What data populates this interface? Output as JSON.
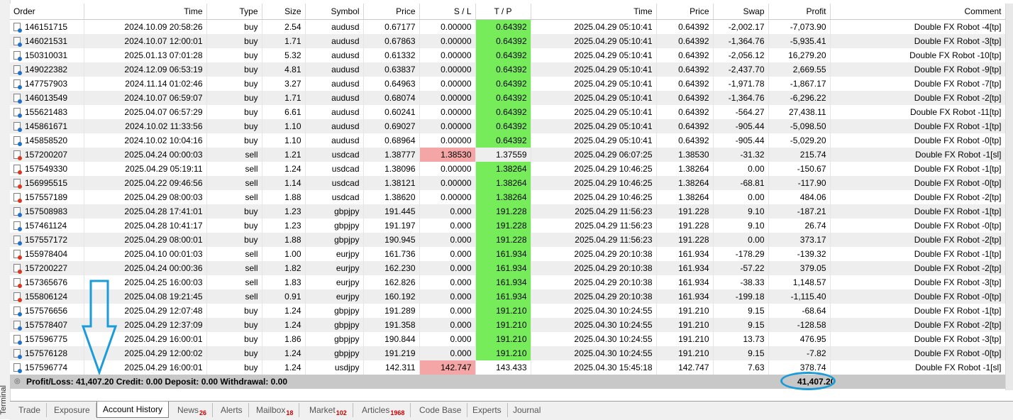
{
  "sidebar": {
    "label": "Terminal"
  },
  "columns": [
    "Order",
    "Time",
    "Type",
    "Size",
    "Symbol",
    "Price",
    "S / L",
    "T / P",
    "Time",
    "Price",
    "Swap",
    "Profit",
    "Comment"
  ],
  "rows": [
    {
      "order": "146151715",
      "open_time": "2024.10.09 20:58:26",
      "type": "buy",
      "size": "2.54",
      "symbol": "audusd",
      "price": "0.67177",
      "sl": "0.00000",
      "tp": "0.64392",
      "close_time": "2025.04.29 05:10:41",
      "close_price": "0.64392",
      "swap": "-2,002.17",
      "profit": "-7,073.90",
      "comment": "Double FX Robot -4[tp]"
    },
    {
      "order": "146021531",
      "open_time": "2024.10.07 12:00:01",
      "type": "buy",
      "size": "1.71",
      "symbol": "audusd",
      "price": "0.67863",
      "sl": "0.00000",
      "tp": "0.64392",
      "close_time": "2025.04.29 05:10:41",
      "close_price": "0.64392",
      "swap": "-1,364.76",
      "profit": "-5,935.41",
      "comment": "Double FX Robot -3[tp]"
    },
    {
      "order": "150310031",
      "open_time": "2025.01.13 07:01:28",
      "type": "buy",
      "size": "5.32",
      "symbol": "audusd",
      "price": "0.61332",
      "sl": "0.00000",
      "tp": "0.64392",
      "close_time": "2025.04.29 05:10:41",
      "close_price": "0.64392",
      "swap": "-2,056.12",
      "profit": "16,279.20",
      "comment": "Double FX Robot -10[tp]"
    },
    {
      "order": "149022382",
      "open_time": "2024.12.09 06:53:19",
      "type": "buy",
      "size": "4.81",
      "symbol": "audusd",
      "price": "0.63837",
      "sl": "0.00000",
      "tp": "0.64392",
      "close_time": "2025.04.29 05:10:41",
      "close_price": "0.64392",
      "swap": "-2,437.70",
      "profit": "2,669.55",
      "comment": "Double FX Robot -9[tp]"
    },
    {
      "order": "147757903",
      "open_time": "2024.11.14 01:02:46",
      "type": "buy",
      "size": "3.27",
      "symbol": "audusd",
      "price": "0.64963",
      "sl": "0.00000",
      "tp": "0.64392",
      "close_time": "2025.04.29 05:10:41",
      "close_price": "0.64392",
      "swap": "-1,971.78",
      "profit": "-1,867.17",
      "comment": "Double FX Robot -7[tp]"
    },
    {
      "order": "146013549",
      "open_time": "2024.10.07 06:59:07",
      "type": "buy",
      "size": "1.71",
      "symbol": "audusd",
      "price": "0.68074",
      "sl": "0.00000",
      "tp": "0.64392",
      "close_time": "2025.04.29 05:10:41",
      "close_price": "0.64392",
      "swap": "-1,364.76",
      "profit": "-6,296.22",
      "comment": "Double FX Robot -2[tp]"
    },
    {
      "order": "155621483",
      "open_time": "2025.04.07 06:57:29",
      "type": "buy",
      "size": "6.61",
      "symbol": "audusd",
      "price": "0.60241",
      "sl": "0.00000",
      "tp": "0.64392",
      "close_time": "2025.04.29 05:10:41",
      "close_price": "0.64392",
      "swap": "-564.27",
      "profit": "27,438.11",
      "comment": "Double FX Robot -11[tp]"
    },
    {
      "order": "145861671",
      "open_time": "2024.10.02 11:33:56",
      "type": "buy",
      "size": "1.10",
      "symbol": "audusd",
      "price": "0.69027",
      "sl": "0.00000",
      "tp": "0.64392",
      "close_time": "2025.04.29 05:10:41",
      "close_price": "0.64392",
      "swap": "-905.44",
      "profit": "-5,098.50",
      "comment": "Double FX Robot -1[tp]"
    },
    {
      "order": "145858520",
      "open_time": "2024.10.02 10:04:16",
      "type": "buy",
      "size": "1.10",
      "symbol": "audusd",
      "price": "0.68964",
      "sl": "0.00000",
      "tp": "0.64392",
      "close_time": "2025.04.29 05:10:41",
      "close_price": "0.64392",
      "swap": "-905.44",
      "profit": "-5,029.20",
      "comment": "Double FX Robot -0[tp]"
    },
    {
      "order": "157200207",
      "open_time": "2025.04.24 00:00:03",
      "type": "sell",
      "size": "1.21",
      "symbol": "usdcad",
      "price": "1.38777",
      "sl": "1.38530",
      "tp": "1.37559",
      "close_time": "2025.04.29 06:07:25",
      "close_price": "1.38530",
      "swap": "-31.32",
      "profit": "215.74",
      "comment": "Double FX Robot -1[sl]"
    },
    {
      "order": "157549330",
      "open_time": "2025.04.29 05:19:11",
      "type": "sell",
      "size": "1.24",
      "symbol": "usdcad",
      "price": "1.38096",
      "sl": "0.00000",
      "tp": "1.38264",
      "close_time": "2025.04.29 10:46:25",
      "close_price": "1.38264",
      "swap": "0.00",
      "profit": "-150.67",
      "comment": "Double FX Robot -1[tp]"
    },
    {
      "order": "156995515",
      "open_time": "2025.04.22 09:46:56",
      "type": "sell",
      "size": "1.14",
      "symbol": "usdcad",
      "price": "1.38121",
      "sl": "0.00000",
      "tp": "1.38264",
      "close_time": "2025.04.29 10:46:25",
      "close_price": "1.38264",
      "swap": "-68.81",
      "profit": "-117.90",
      "comment": "Double FX Robot -0[tp]"
    },
    {
      "order": "157557189",
      "open_time": "2025.04.29 08:00:03",
      "type": "sell",
      "size": "1.88",
      "symbol": "usdcad",
      "price": "1.38620",
      "sl": "0.00000",
      "tp": "1.38264",
      "close_time": "2025.04.29 10:46:25",
      "close_price": "1.38264",
      "swap": "0.00",
      "profit": "484.06",
      "comment": "Double FX Robot -2[tp]"
    },
    {
      "order": "157508983",
      "open_time": "2025.04.28 17:41:01",
      "type": "buy",
      "size": "1.23",
      "symbol": "gbpjpy",
      "price": "191.445",
      "sl": "0.000",
      "tp": "191.228",
      "close_time": "2025.04.29 11:56:23",
      "close_price": "191.228",
      "swap": "9.10",
      "profit": "-187.21",
      "comment": "Double FX Robot -1[tp]"
    },
    {
      "order": "157461124",
      "open_time": "2025.04.28 10:41:17",
      "type": "buy",
      "size": "1.23",
      "symbol": "gbpjpy",
      "price": "191.197",
      "sl": "0.000",
      "tp": "191.228",
      "close_time": "2025.04.29 11:56:23",
      "close_price": "191.228",
      "swap": "9.10",
      "profit": "26.74",
      "comment": "Double FX Robot -0[tp]"
    },
    {
      "order": "157557172",
      "open_time": "2025.04.29 08:00:01",
      "type": "buy",
      "size": "1.88",
      "symbol": "gbpjpy",
      "price": "190.945",
      "sl": "0.000",
      "tp": "191.228",
      "close_time": "2025.04.29 11:56:23",
      "close_price": "191.228",
      "swap": "0.00",
      "profit": "373.17",
      "comment": "Double FX Robot -2[tp]"
    },
    {
      "order": "155978404",
      "open_time": "2025.04.10 00:01:03",
      "type": "sell",
      "size": "1.00",
      "symbol": "eurjpy",
      "price": "161.736",
      "sl": "0.000",
      "tp": "161.934",
      "close_time": "2025.04.29 20:10:38",
      "close_price": "161.934",
      "swap": "-178.29",
      "profit": "-139.32",
      "comment": "Double FX Robot -1[tp]"
    },
    {
      "order": "157200227",
      "open_time": "2025.04.24 00:00:36",
      "type": "sell",
      "size": "1.82",
      "symbol": "eurjpy",
      "price": "162.230",
      "sl": "0.000",
      "tp": "161.934",
      "close_time": "2025.04.29 20:10:38",
      "close_price": "161.934",
      "swap": "-57.22",
      "profit": "379.05",
      "comment": "Double FX Robot -2[tp]"
    },
    {
      "order": "157365676",
      "open_time": "2025.04.25 16:00:03",
      "type": "sell",
      "size": "1.83",
      "symbol": "eurjpy",
      "price": "162.826",
      "sl": "0.000",
      "tp": "161.934",
      "close_time": "2025.04.29 20:10:38",
      "close_price": "161.934",
      "swap": "-38.33",
      "profit": "1,148.57",
      "comment": "Double FX Robot -3[tp]"
    },
    {
      "order": "155806124",
      "open_time": "2025.04.08 19:21:45",
      "type": "sell",
      "size": "0.91",
      "symbol": "eurjpy",
      "price": "160.192",
      "sl": "0.000",
      "tp": "161.934",
      "close_time": "2025.04.29 20:10:38",
      "close_price": "161.934",
      "swap": "-199.18",
      "profit": "-1,115.40",
      "comment": "Double FX Robot -0[tp]"
    },
    {
      "order": "157576656",
      "open_time": "2025.04.29 12:07:48",
      "type": "buy",
      "size": "1.24",
      "symbol": "gbpjpy",
      "price": "191.289",
      "sl": "0.000",
      "tp": "191.210",
      "close_time": "2025.04.30 10:24:55",
      "close_price": "191.210",
      "swap": "9.15",
      "profit": "-68.64",
      "comment": "Double FX Robot -1[tp]"
    },
    {
      "order": "157578407",
      "open_time": "2025.04.29 12:37:09",
      "type": "buy",
      "size": "1.24",
      "symbol": "gbpjpy",
      "price": "191.358",
      "sl": "0.000",
      "tp": "191.210",
      "close_time": "2025.04.30 10:24:55",
      "close_price": "191.210",
      "swap": "9.15",
      "profit": "-128.58",
      "comment": "Double FX Robot -2[tp]"
    },
    {
      "order": "157596775",
      "open_time": "2025.04.29 16:00:01",
      "type": "buy",
      "size": "1.86",
      "symbol": "gbpjpy",
      "price": "190.844",
      "sl": "0.000",
      "tp": "191.210",
      "close_time": "2025.04.30 10:24:55",
      "close_price": "191.210",
      "swap": "13.73",
      "profit": "476.95",
      "comment": "Double FX Robot -3[tp]"
    },
    {
      "order": "157576128",
      "open_time": "2025.04.29 12:00:02",
      "type": "buy",
      "size": "1.24",
      "symbol": "gbpjpy",
      "price": "191.219",
      "sl": "0.000",
      "tp": "191.210",
      "close_time": "2025.04.30 10:24:55",
      "close_price": "191.210",
      "swap": "9.15",
      "profit": "-7.82",
      "comment": "Double FX Robot -0[tp]"
    },
    {
      "order": "157596774",
      "open_time": "2025.04.29 16:00:01",
      "type": "buy",
      "size": "1.24",
      "symbol": "usdjpy",
      "price": "142.311",
      "sl": "142.747",
      "tp": "143.433",
      "close_time": "2025.04.30 15:45:18",
      "close_price": "142.747",
      "swap": "7.63",
      "profit": "378.74",
      "comment": "Double FX Robot -1[sl]"
    }
  ],
  "summary": {
    "text": "Profit/Loss: 41,407.20  Credit: 0.00  Deposit: 0.00  Withdrawal: 0.00",
    "total": "41,407.20"
  },
  "tabs": [
    {
      "label": "Trade",
      "badge": ""
    },
    {
      "label": "Exposure",
      "badge": ""
    },
    {
      "label": "Account History",
      "badge": "",
      "active": true
    },
    {
      "label": "News",
      "badge": "26"
    },
    {
      "label": "Alerts",
      "badge": ""
    },
    {
      "label": "Mailbox",
      "badge": "18"
    },
    {
      "label": "Market",
      "badge": "102"
    },
    {
      "label": "Articles",
      "badge": "1968"
    },
    {
      "label": "Code Base",
      "badge": ""
    },
    {
      "label": "Experts",
      "badge": ""
    },
    {
      "label": "Journal",
      "badge": ""
    }
  ],
  "colors": {
    "tp_hit": "#77ec5a",
    "sl_hit": "#f4a6a6",
    "annotation": "#1b9cd8"
  },
  "icons": {
    "buy_row": "order-buy-icon",
    "sell_row": "order-sell-icon",
    "summary": "summary-circle-icon"
  }
}
